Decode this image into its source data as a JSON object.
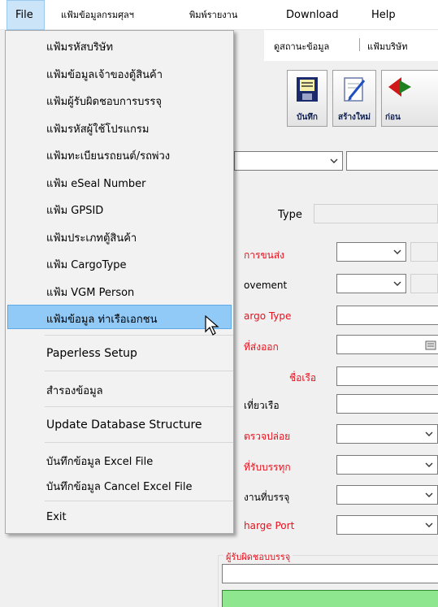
{
  "menubar": {
    "items": [
      {
        "label": "File"
      },
      {
        "label": "แฟ้มข้อมูลกรมศุลฯ"
      },
      {
        "label": "พิมพ์รายงาน"
      },
      {
        "label": "Download"
      },
      {
        "label": "Help"
      }
    ]
  },
  "subtoolbar": {
    "status_label": "ดูสถานะข้อมูล",
    "company_label": "แฟ้มบริษัท"
  },
  "toolbar": {
    "save_label": "บันทึก",
    "new_label": "สร้างใหม่",
    "prev_label": "ก่อน"
  },
  "form": {
    "type_label": "Type",
    "transport_label": "การขนส่ง",
    "movement_label": "ovement",
    "cargo_type_label": "argo Type",
    "departure_label": "ที่ส่งออก",
    "ship_name_label": "ชื่อเรือ",
    "voyage_label": "เที่ยวเรือ",
    "release_label": "ตรวจปล่อย",
    "loading_label": "ที่รับบรรทุก",
    "packing_label": "งานที่บรรจุ",
    "discharge_label": "harge Port",
    "group_title": "ผู้รับผิดชอบบรรจุ"
  },
  "file_menu": {
    "items": [
      {
        "label": "แฟ้มรหัสบริษัท"
      },
      {
        "label": "แฟ้มข้อมูลเจ้าของตู้สินค้า"
      },
      {
        "label": "แฟ้มผู้รับผิดชอบการบรรจุ"
      },
      {
        "label": "แฟ้มรหัสผู้ใช้โปรแกรม"
      },
      {
        "label": "แฟ้มทะเบียนรถยนต์/รถพ่วง"
      },
      {
        "label": "แฟ้ม eSeal Number"
      },
      {
        "label": "แฟ้ม GPSID"
      },
      {
        "label": "แฟ้มประเภทตู้สินค้า"
      },
      {
        "label": "แฟ้ม CargoType"
      },
      {
        "label": "แฟ้ม VGM Person"
      },
      {
        "label": "แฟ้มข้อมูล ท่าเรือเอกชน"
      },
      {
        "label": "Paperless Setup"
      },
      {
        "label": "สำรองข้อมูล"
      },
      {
        "label": "Update Database Structure"
      },
      {
        "label": "บันทึกข้อมูล Excel File"
      },
      {
        "label": "บันทึกข้อมูล Cancel Excel File"
      },
      {
        "label": "Exit"
      }
    ]
  },
  "colors": {
    "highlight": "#91c9f7",
    "required_label": "#e8101c",
    "green_bar": "#8ee68e"
  }
}
